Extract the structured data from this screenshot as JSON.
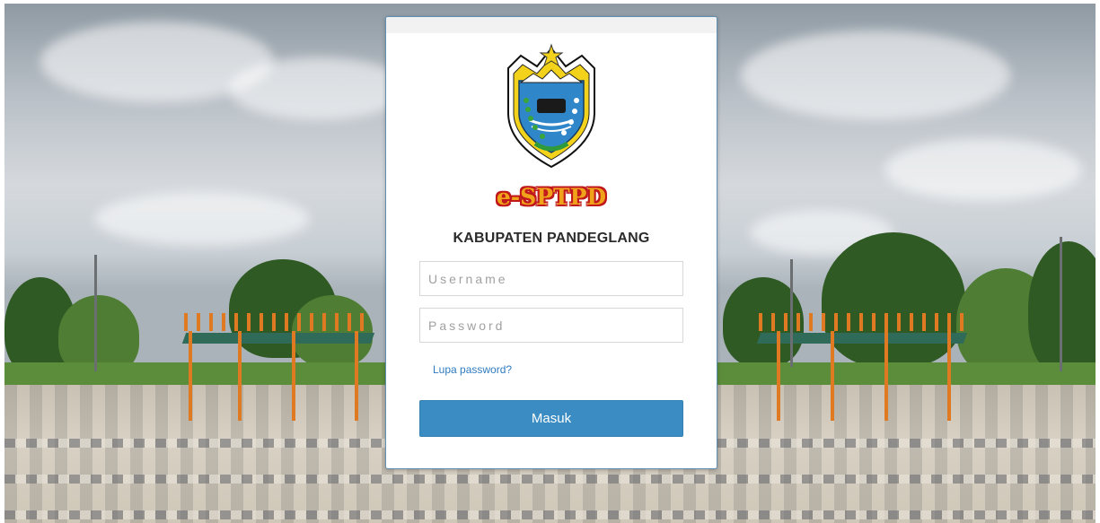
{
  "brand": {
    "name": "e-SPTPD",
    "organization": "KABUPATEN PANDEGLANG",
    "colors": {
      "fill": "#f0a21a",
      "outline": "#c0181b"
    }
  },
  "login": {
    "username_placeholder": "Username",
    "username_value": "",
    "password_placeholder": "Password",
    "password_value": "",
    "forgot_label": "Lupa password?",
    "submit_label": "Masuk"
  },
  "theme": {
    "accent": "#3a8cc2",
    "link": "#2f7bbf",
    "card_border": "#5f8fb3"
  },
  "icons": {
    "logo": "crest-icon"
  }
}
